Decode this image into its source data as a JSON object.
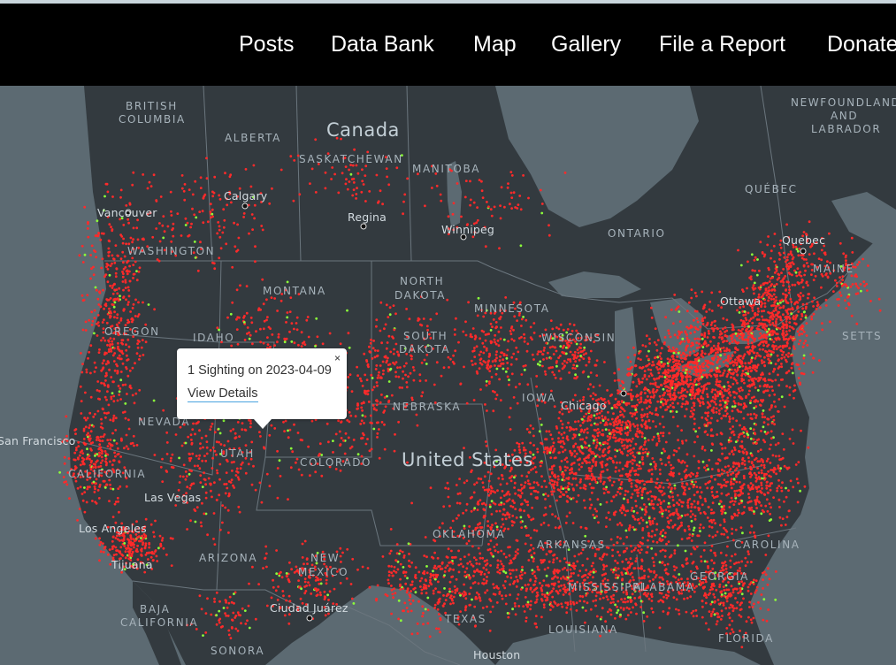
{
  "nav": {
    "items": [
      {
        "label": "Posts"
      },
      {
        "label": "Data Bank"
      },
      {
        "label": "Map"
      },
      {
        "label": "Gallery"
      },
      {
        "label": "File a Report"
      },
      {
        "label": "Donate"
      }
    ]
  },
  "map": {
    "colors": {
      "water": "#5c6a72",
      "land": "#333a3f",
      "borders": "#6b767e",
      "sighting_dot": "#ff2a2a",
      "recent_sighting_dot": "#8cff3a",
      "popup_link_underline": "#4aa3df"
    },
    "labels": {
      "countries": [
        {
          "text": "Canada"
        },
        {
          "text": "United States"
        }
      ],
      "regions": [
        {
          "text": "BRITISH"
        },
        {
          "text": "COLUMBIA"
        },
        {
          "text": "ALBERTA"
        },
        {
          "text": "SASKATCHEWAN"
        },
        {
          "text": "MANITOBA"
        },
        {
          "text": "ONTARIO"
        },
        {
          "text": "QUÉBEC"
        },
        {
          "text": "NEWFOUNDLAND"
        },
        {
          "text": "AND"
        },
        {
          "text": "LABRADOR"
        },
        {
          "text": "WASHINGTON"
        },
        {
          "text": "MONTANA"
        },
        {
          "text": "NORTH"
        },
        {
          "text": "DAKOTA"
        },
        {
          "text": "SOUTH"
        },
        {
          "text": "DAKOTA"
        },
        {
          "text": "MINNESOTA"
        },
        {
          "text": "WISCONSIN"
        },
        {
          "text": "OREGON"
        },
        {
          "text": "IDAHO"
        },
        {
          "text": "NEBRASKA"
        },
        {
          "text": "IOWA"
        },
        {
          "text": "NEVADA"
        },
        {
          "text": "UTAH"
        },
        {
          "text": "COLORADO"
        },
        {
          "text": "CALIFORNIA"
        },
        {
          "text": "ARIZONA"
        },
        {
          "text": "NEW"
        },
        {
          "text": "MEXICO"
        },
        {
          "text": "OKLAHOMA"
        },
        {
          "text": "ARKANSAS"
        },
        {
          "text": "MISSISSIPPI"
        },
        {
          "text": "ALABAMA"
        },
        {
          "text": "GEORGIA"
        },
        {
          "text": "CAROLINA"
        },
        {
          "text": "TEXAS"
        },
        {
          "text": "LOUISIANA"
        },
        {
          "text": "FLORIDA"
        },
        {
          "text": "MAINE"
        },
        {
          "text": "SETTS"
        },
        {
          "text": "BAJA"
        },
        {
          "text": "CALIFORNIA"
        },
        {
          "text": "SONORA"
        }
      ],
      "cities": [
        {
          "text": "Calgary"
        },
        {
          "text": "Vancouver"
        },
        {
          "text": "Regina"
        },
        {
          "text": "Winnipeg"
        },
        {
          "text": "Quebec"
        },
        {
          "text": "Ottawa"
        },
        {
          "text": "Chicago"
        },
        {
          "text": "San Francisco"
        },
        {
          "text": "Las Vegas"
        },
        {
          "text": "Los Angeles"
        },
        {
          "text": "Tijuana"
        },
        {
          "text": "Ciudad Juárez"
        },
        {
          "text": "Houston"
        }
      ]
    }
  },
  "popup": {
    "title": "1 Sighting on 2023-04-09",
    "link": "View Details",
    "close_glyph": "×"
  }
}
